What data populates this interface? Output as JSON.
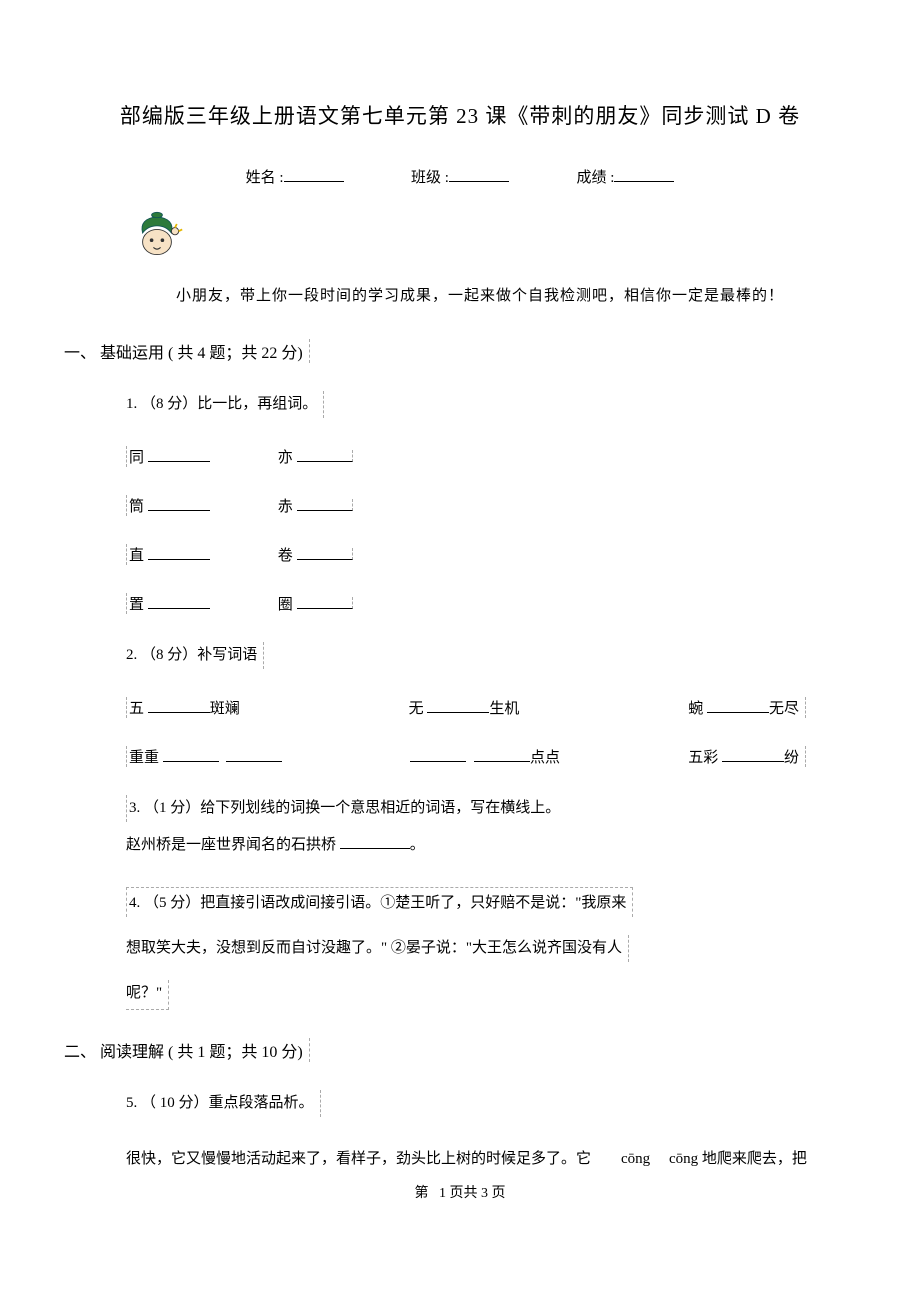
{
  "title": "部编版三年级上册语文第七单元第 23 课《带刺的朋友》同步测试 D 卷",
  "info": {
    "name_label": "姓名 :",
    "class_label": "班级 :",
    "score_label": "成绩 :"
  },
  "intro": "小朋友，带上你一段时间的学习成果，一起来做个自我检测吧，相信你一定是最棒的！",
  "sections": [
    {
      "id": "s1",
      "header": "一、  基础运用 ( 共 4 题；共 22 分)",
      "questions": [
        {
          "id": "q1",
          "prompt": "1.  （8 分）比一比，再组词。",
          "pairs": [
            {
              "left": "同",
              "right": "亦"
            },
            {
              "left": "筒",
              "right": "赤"
            },
            {
              "left": "直",
              "right": "卷"
            },
            {
              "left": "置",
              "right": "圈"
            }
          ]
        },
        {
          "id": "q2",
          "prompt": "2.  （8 分）补写词语",
          "row1": [
            {
              "pre": "五",
              "post": "斑斓"
            },
            {
              "pre": "无",
              "post": "生机"
            },
            {
              "pre": "蜿",
              "post": "无尽"
            }
          ],
          "row2": [
            {
              "pre": "重重",
              "post": ""
            },
            {
              "pre": "",
              "post": "点点"
            },
            {
              "pre": "五彩",
              "post": "纷"
            }
          ]
        },
        {
          "id": "q3",
          "prompt": "3.  （1 分）给下列划线的词换一个意思相近的词语，写在横线上。",
          "line": "赵州桥是一座世界闻名的石拱桥",
          "tail": "。"
        },
        {
          "id": "q4",
          "prompt_a": "4.  （5 分）把直接引语改成间接引语。①楚王听了，只好赔不是说：\"我原来",
          "prompt_b": "想取笑大夫，没想到反而自讨没趣了。\" ②晏子说：\"大王怎么说齐国没有人",
          "prompt_c": "呢？\""
        }
      ]
    },
    {
      "id": "s2",
      "header": "二、  阅读理解 ( 共 1 题；共 10 分)",
      "questions": [
        {
          "id": "q5",
          "prompt": "5.  （ 10 分）重点段落品析。",
          "para_a": "很快，它又慢慢地活动起来了，看样子，劲头比上树的时候足多了。它",
          "para_b": "cōng",
          "para_c": "cōng 地爬来爬去，把"
        }
      ]
    }
  ],
  "footer": {
    "prefix": "第",
    "mid": "1 页共 3 页"
  }
}
